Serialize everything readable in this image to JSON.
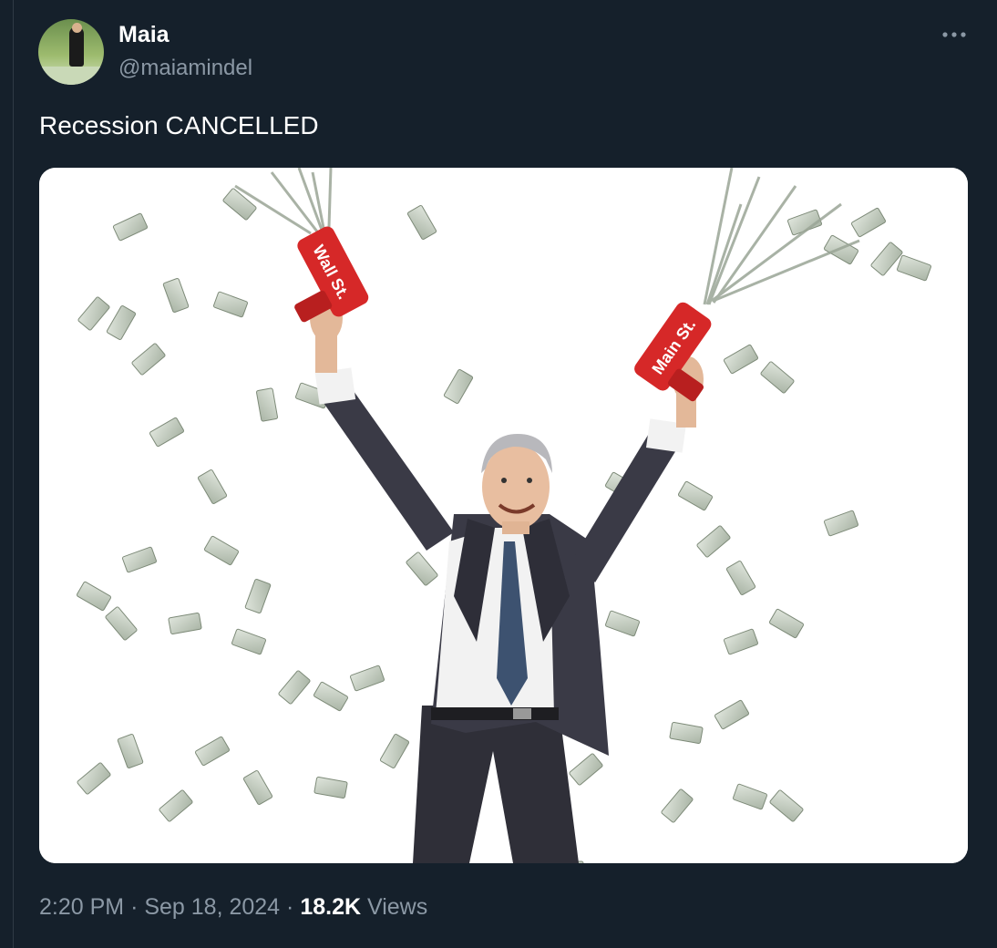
{
  "author": {
    "name": "Maia",
    "handle": "@maiamindel"
  },
  "menu_icon": "more-horizontal-icon",
  "post": {
    "text": "Recession CANCELLED"
  },
  "image": {
    "left_gun_label": "Wall St.",
    "right_gun_label": "Main St."
  },
  "meta": {
    "time": "2:20 PM",
    "separator": "·",
    "date": "Sep 18, 2024",
    "views_count": "18.2K",
    "views_label": "Views"
  },
  "colors": {
    "background": "#15202b",
    "primary_text": "#ffffff",
    "secondary_text": "#8b98a5",
    "gun_red": "#d62828"
  }
}
